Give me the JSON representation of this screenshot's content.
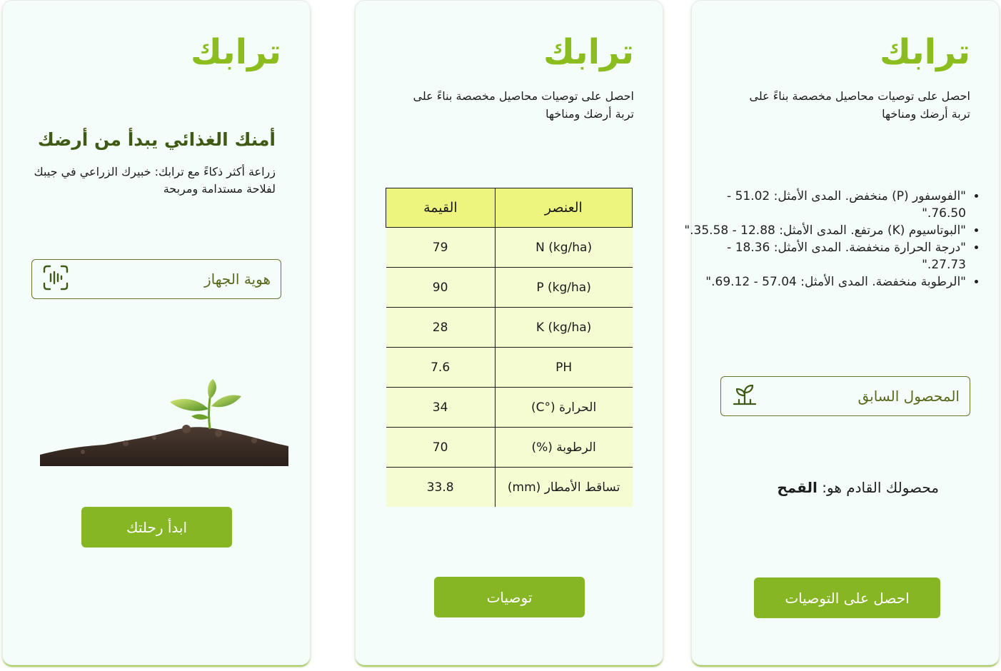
{
  "brand": {
    "logo_text": "ترابك",
    "accent": "#86b623",
    "logo_color": "#8cbd1f"
  },
  "screen_recommendations": {
    "subtitle": "احصل على توصيات محاصيل مخصصة بناءً على تربة أرضك ومناخها",
    "issues": [
      "\"الفوسفور (P) منخفض. المدى الأمثل: 51.02 - 76.50.\"",
      "\"البوتاسيوم (K) مرتفع. المدى الأمثل: 12.88 - 35.58.\"",
      "\"درجة الحرارة منخفضة. المدى الأمثل: 18.36 - 27.73.\"",
      "\"الرطوبة منخفضة. المدى الأمثل: 57.04 - 69.12.\""
    ],
    "previous_crop_label": "المحصول السابق",
    "previous_crop_icon": "sprout-icon",
    "result_prefix": "محصولك القادم هو:",
    "result_crop": "القمح",
    "get_recommendations_button": "احصل على التوصيات"
  },
  "screen_soil_table": {
    "subtitle": "احصل على توصيات محاصيل مخصصة بناءً على تربة أرضك ومناخها",
    "columns": {
      "element": "العنصر",
      "value": "القيمة"
    },
    "rows": [
      {
        "element": "N (kg/ha)",
        "value": "79"
      },
      {
        "element": "P (kg/ha)",
        "value": "90"
      },
      {
        "element": "K (kg/ha)",
        "value": "28"
      },
      {
        "element": "PH",
        "value": "7.6"
      },
      {
        "element": "الحرارة (°C)",
        "value": "34"
      },
      {
        "element": "الرطوبة (%)",
        "value": "70"
      },
      {
        "element": "تساقط الأمطار (mm)",
        "value": "33.8"
      }
    ],
    "recommendations_button": "توصيات"
  },
  "screen_welcome": {
    "headline": "أمنك الغذائي يبدأ من أرضك",
    "tagline": "زراعة أكثر ذكاءً مع ترابك: خبيرك الزراعي في جيبك لفلاحة مستدامة ومربحة",
    "device_id_label": "هوية الجهاز",
    "device_id_icon": "scan-icon",
    "illustration": "soil-sprout-image",
    "start_button": "ابدأ رحلتك"
  }
}
